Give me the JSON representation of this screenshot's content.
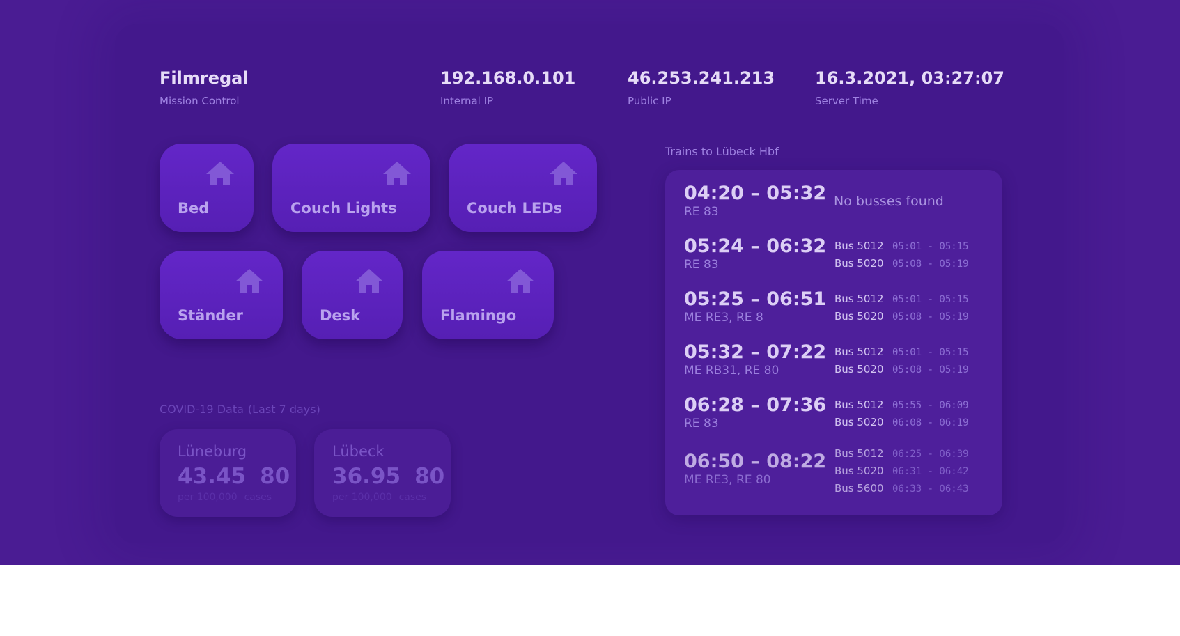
{
  "header": {
    "app_name": "Filmregal",
    "app_subtitle": "Mission Control",
    "internal_ip": "192.168.0.101",
    "internal_ip_label": "Internal IP",
    "public_ip": "46.253.241.213",
    "public_ip_label": "Public IP",
    "server_time": "16.3.2021, 03:27:07",
    "server_time_label": "Server Time"
  },
  "lights": [
    {
      "label": "Bed",
      "icon": "home-icon"
    },
    {
      "label": "Couch Lights",
      "icon": "home-icon"
    },
    {
      "label": "Couch LEDs",
      "icon": "home-icon"
    },
    {
      "label": "Ständer",
      "icon": "home-icon"
    },
    {
      "label": "Desk",
      "icon": "home-icon"
    },
    {
      "label": "Flamingo",
      "icon": "home-icon"
    }
  ],
  "covid": {
    "title": "COVID-19 Data",
    "subtitle": "(Last 7 days)",
    "cities": [
      {
        "name": "Lüneburg",
        "incidence": "43.45",
        "cases": "80",
        "incidence_unit": "per 100,000",
        "cases_unit": "cases"
      },
      {
        "name": "Lübeck",
        "incidence": "36.95",
        "cases": "80",
        "incidence_unit": "per 100,000",
        "cases_unit": "cases"
      }
    ]
  },
  "trains": {
    "title": "Trains to Lübeck Hbf",
    "no_busses_text": "No busses found",
    "connections": [
      {
        "time": "04:20 – 05:32",
        "lines": "RE 83",
        "buses": []
      },
      {
        "time": "05:24 – 06:32",
        "lines": "RE 83",
        "buses": [
          {
            "name": "Bus 5012",
            "time": "05:01 - 05:15"
          },
          {
            "name": "Bus 5020",
            "time": "05:08 - 05:19"
          }
        ]
      },
      {
        "time": "05:25 – 06:51",
        "lines": "ME RE3, RE 8",
        "buses": [
          {
            "name": "Bus 5012",
            "time": "05:01 - 05:15"
          },
          {
            "name": "Bus 5020",
            "time": "05:08 - 05:19"
          }
        ]
      },
      {
        "time": "05:32 – 07:22",
        "lines": "ME RB31, RE 80",
        "buses": [
          {
            "name": "Bus 5012",
            "time": "05:01 - 05:15"
          },
          {
            "name": "Bus 5020",
            "time": "05:08 - 05:19"
          }
        ]
      },
      {
        "time": "06:28 – 07:36",
        "lines": "RE 83",
        "buses": [
          {
            "name": "Bus 5012",
            "time": "05:55 - 06:09"
          },
          {
            "name": "Bus 5020",
            "time": "06:08 - 06:19"
          }
        ]
      },
      {
        "time": "06:50 – 08:22",
        "lines": "ME RE3, RE 80",
        "buses": [
          {
            "name": "Bus 5012",
            "time": "06:25 - 06:39"
          },
          {
            "name": "Bus 5020",
            "time": "06:31 - 06:42"
          },
          {
            "name": "Bus 5600",
            "time": "06:33 - 06:43"
          }
        ]
      }
    ]
  }
}
